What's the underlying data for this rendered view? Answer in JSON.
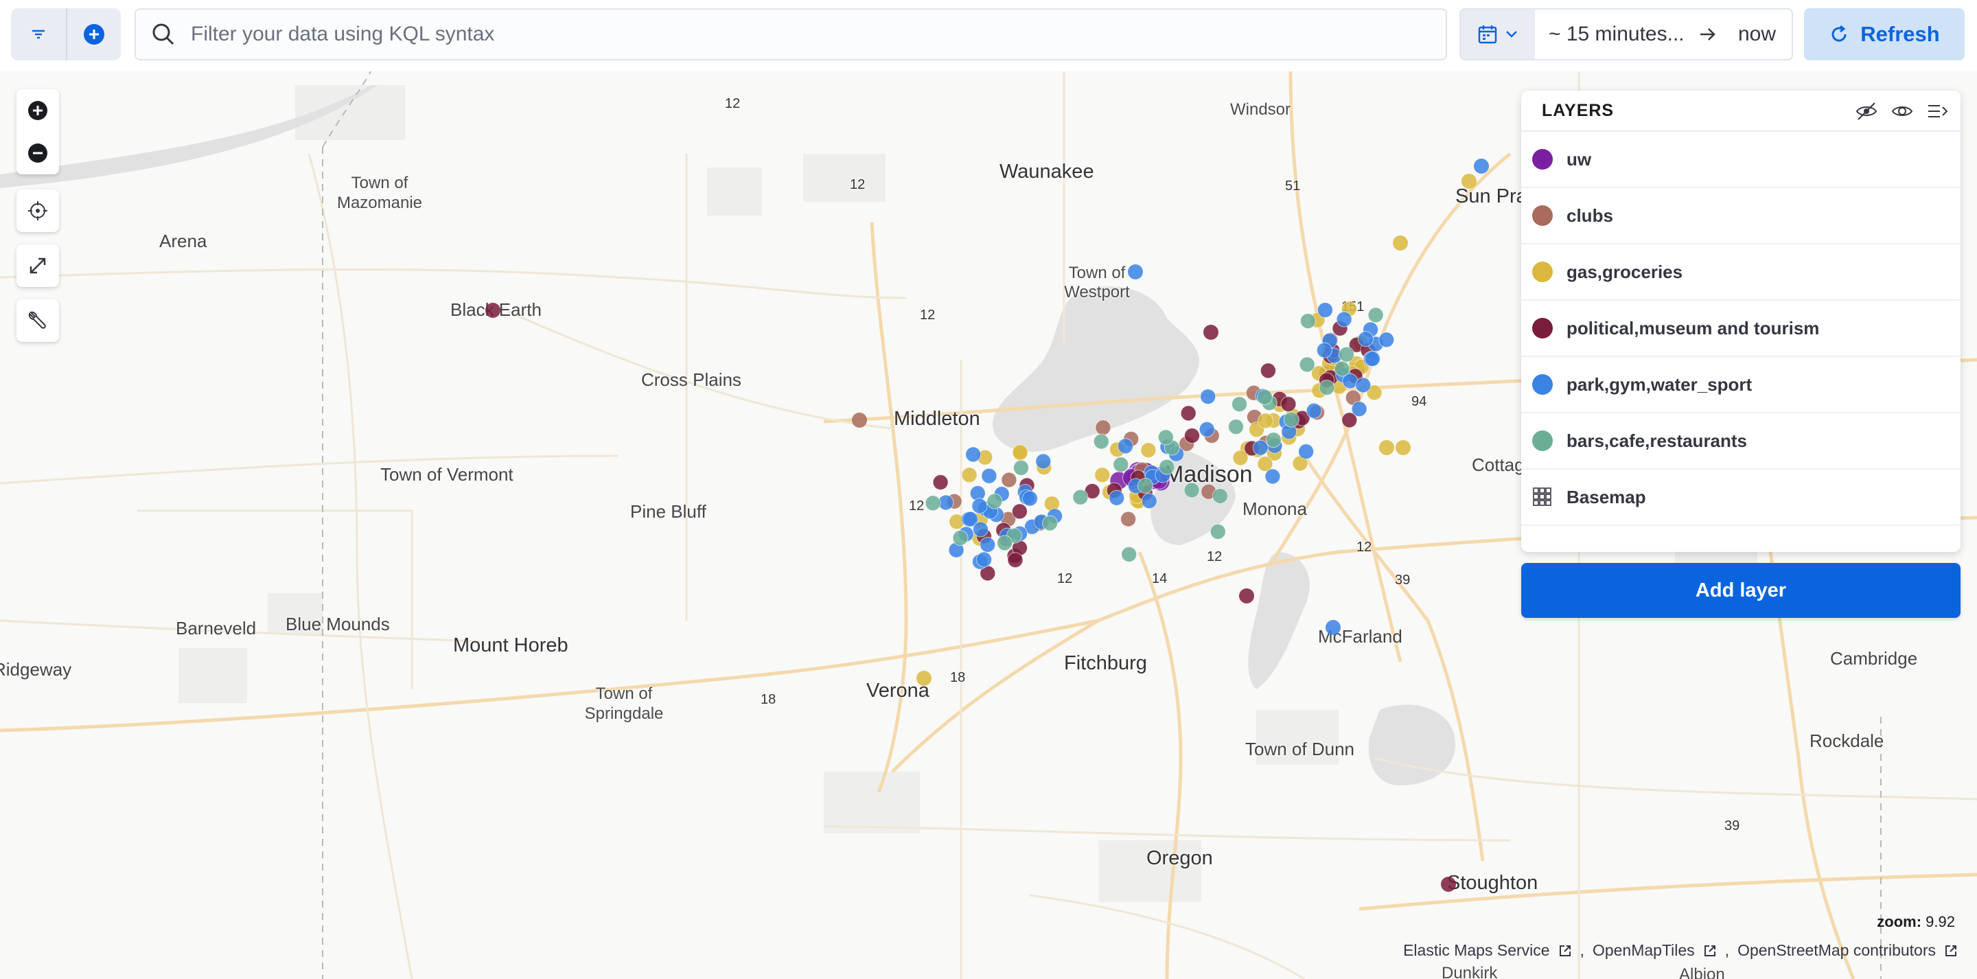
{
  "query_bar": {
    "search_placeholder": "Filter your data using KQL syntax",
    "time_start": "~ 15 minutes...",
    "time_end": "now",
    "refresh_label": "Refresh"
  },
  "map": {
    "places": [
      {
        "label": "Windsor",
        "size": "small"
      },
      {
        "label": "Waunakee",
        "size": "large"
      },
      {
        "label": "Town of Mazomanie",
        "size": "small"
      },
      {
        "label": "Arena",
        "size": "medium"
      },
      {
        "label": "Black Earth",
        "size": "medium"
      },
      {
        "label": "Town of Westport",
        "size": "small"
      },
      {
        "label": "Cross Plains",
        "size": "medium"
      },
      {
        "label": "Middleton",
        "size": "large"
      },
      {
        "label": "Town of Vermont",
        "size": "medium"
      },
      {
        "label": "Pine Bluff",
        "size": "medium"
      },
      {
        "label": "Madison",
        "size": "large"
      },
      {
        "label": "Monona",
        "size": "medium"
      },
      {
        "label": "Cottage Grove",
        "size": "medium"
      },
      {
        "label": "Sun Prairie",
        "size": "large"
      },
      {
        "label": "Barneveld",
        "size": "medium"
      },
      {
        "label": "Blue Mounds",
        "size": "medium"
      },
      {
        "label": "Mount Horeb",
        "size": "large"
      },
      {
        "label": "Ridgeway",
        "size": "medium"
      },
      {
        "label": "Town of Springdale",
        "size": "small"
      },
      {
        "label": "Verona",
        "size": "large"
      },
      {
        "label": "Fitchburg",
        "size": "large"
      },
      {
        "label": "McFarland",
        "size": "medium"
      },
      {
        "label": "Cambridge",
        "size": "medium"
      },
      {
        "label": "Town of Dunn",
        "size": "medium"
      },
      {
        "label": "Rockdale",
        "size": "medium"
      },
      {
        "label": "Oregon",
        "size": "large"
      },
      {
        "label": "Stoughton",
        "size": "large"
      },
      {
        "label": "Dunkirk",
        "size": "small"
      },
      {
        "label": "Albion",
        "size": "small"
      }
    ],
    "route_shields": [
      "12",
      "12",
      "12",
      "51",
      "151",
      "94",
      "12",
      "12",
      "14",
      "12",
      "12",
      "39",
      "18",
      "18",
      "39"
    ],
    "controls": {
      "zoom_in": "plus-icon",
      "zoom_out": "minus-icon",
      "reset": "crosshair-icon",
      "fullscreen": "expand-icon",
      "tools": "wrench-icon"
    },
    "points": {
      "uw": {
        "color": "#7b1fa2",
        "count": 30
      },
      "clubs": {
        "color": "#a86b5c",
        "count": 22
      },
      "gas_groceries": {
        "color": "#dab83d",
        "count": 45
      },
      "political_museum_tourism": {
        "color": "#7a1c3c",
        "count": 30
      },
      "park_gym_water_sport": {
        "color": "#3a82e4",
        "count": 60
      },
      "bars_cafe_restaurants": {
        "color": "#6aae96",
        "count": 30
      }
    }
  },
  "layers_panel": {
    "title": "LAYERS",
    "layers": [
      {
        "name": "uw",
        "color": "#7b1fa2",
        "type": "dot"
      },
      {
        "name": "clubs",
        "color": "#a86b5c",
        "type": "dot"
      },
      {
        "name": "gas,groceries",
        "color": "#dab83d",
        "type": "dot"
      },
      {
        "name": "political,museum and tourism",
        "color": "#7a1c3c",
        "type": "dot"
      },
      {
        "name": "park,gym,water_sport",
        "color": "#3a82e4",
        "type": "dot"
      },
      {
        "name": "bars,cafe,restaurants",
        "color": "#6aae96",
        "type": "dot"
      },
      {
        "name": "Basemap",
        "color": "#343741",
        "type": "grid"
      }
    ],
    "add_layer_label": "Add layer"
  },
  "status": {
    "zoom_label": "zoom:",
    "zoom_value": "9.92",
    "attribution": [
      "Elastic Maps Service",
      "OpenMapTiles",
      "OpenStreetMap contributors"
    ]
  }
}
